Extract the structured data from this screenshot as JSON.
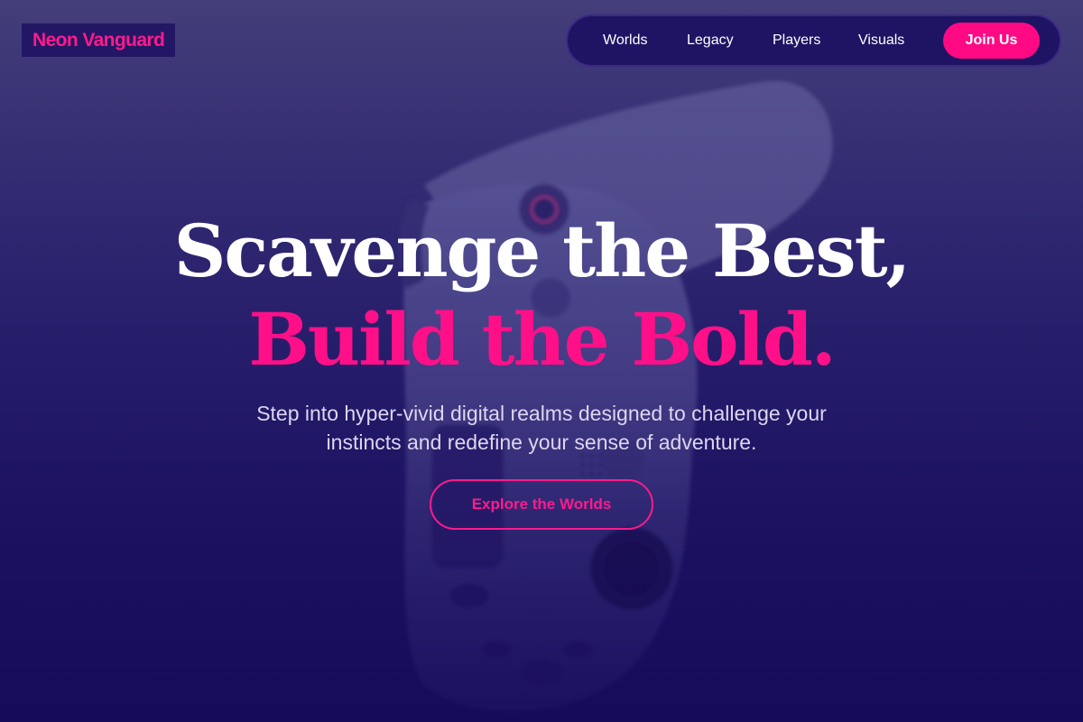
{
  "brand": {
    "name": "Neon Vanguard"
  },
  "nav": {
    "links": [
      "Worlds",
      "Legacy",
      "Players",
      "Visuals"
    ],
    "join_label": "Join Us"
  },
  "hero": {
    "headline_line1": "Scavenge the Best,",
    "headline_line2": "Build the Bold.",
    "subtitle": "Step into hyper-vivid digital realms designed to challenge your instincts and redefine your sense of adventure.",
    "cta_label": "Explore the Worlds"
  },
  "colors": {
    "accent": "#ff0a84",
    "background_top": "#46417a",
    "background_bottom": "#170c5c",
    "nav_bg": "#1f1464"
  },
  "background_image": {
    "subject": "game-controller-photo"
  }
}
